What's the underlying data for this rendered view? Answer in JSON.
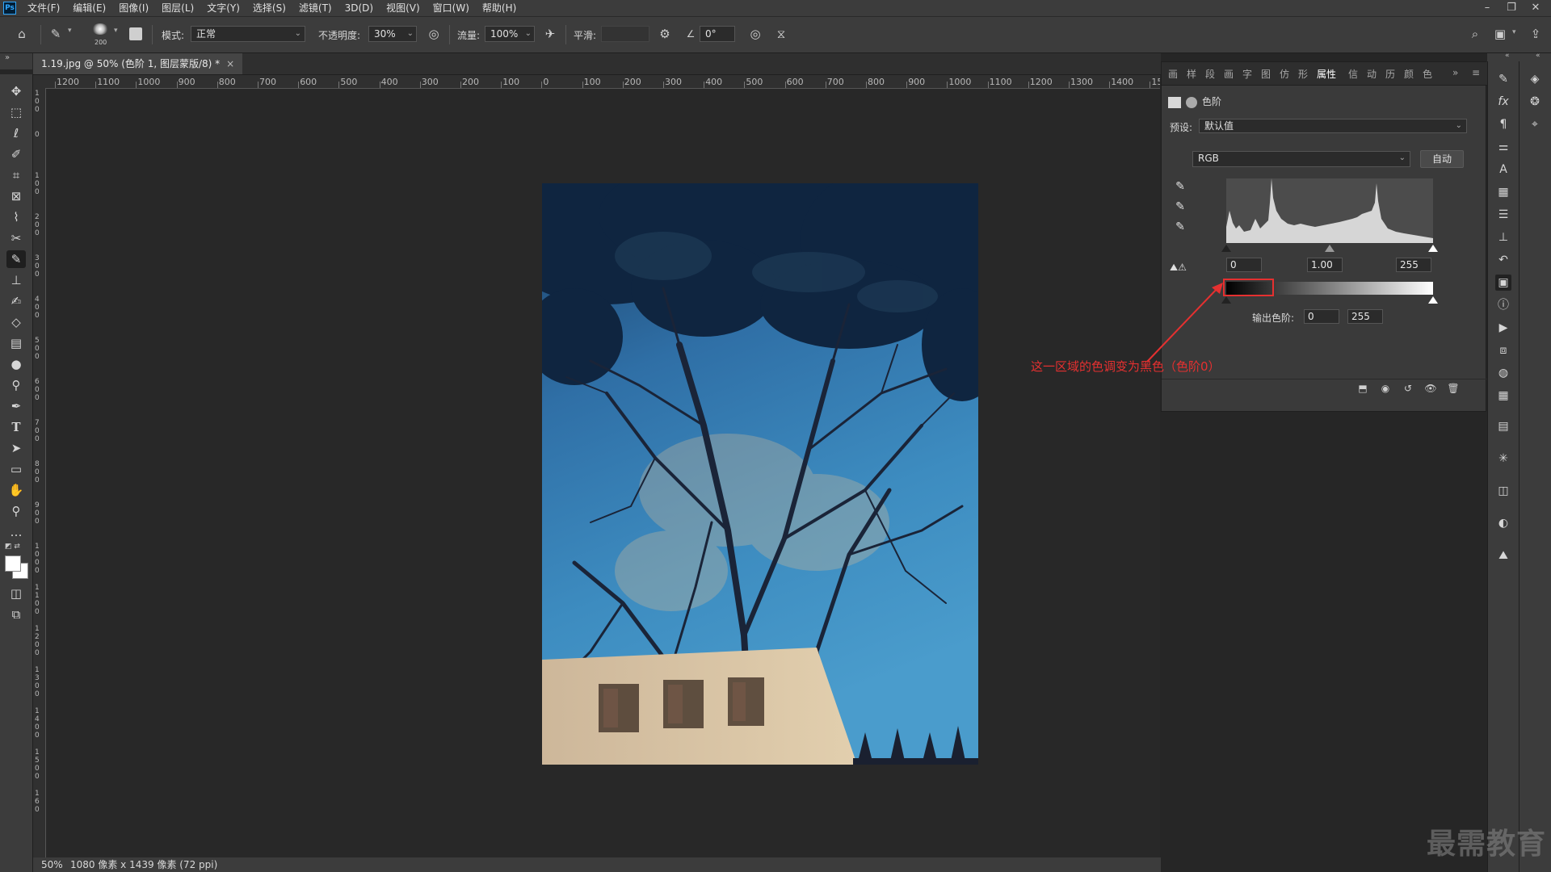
{
  "menubar": {
    "logo": "Ps",
    "items": [
      "文件(F)",
      "编辑(E)",
      "图像(I)",
      "图层(L)",
      "文字(Y)",
      "选择(S)",
      "滤镜(T)",
      "3D(D)",
      "视图(V)",
      "窗口(W)",
      "帮助(H)"
    ],
    "window_controls": [
      "–",
      "❐",
      "✕"
    ]
  },
  "options": {
    "brush_size": "200",
    "mode_label": "模式:",
    "mode_value": "正常",
    "opacity_label": "不透明度:",
    "opacity_value": "30%",
    "flow_label": "流量:",
    "flow_value": "100%",
    "smooth_label": "平滑:",
    "smooth_value": "",
    "angle_value": "0°"
  },
  "document": {
    "tab_title": "1.19.jpg @ 50% (色阶 1, 图层蒙版/8) *",
    "tab_close": "×"
  },
  "ruler": {
    "h_labels": [
      "1200",
      "1100",
      "1000",
      "900",
      "800",
      "700",
      "600",
      "500",
      "400",
      "300",
      "200",
      "100",
      "0",
      "100",
      "200",
      "300",
      "400",
      "500",
      "600",
      "700",
      "800",
      "900",
      "1000",
      "1100",
      "1200",
      "1300",
      "1400",
      "15"
    ],
    "v_labels": [
      "1 0 0",
      "0",
      "1 0 0",
      "2 0 0",
      "3 0 0",
      "4 0 0",
      "5 0 0",
      "6 0 0",
      "7 0 0",
      "8 0 0",
      "9 0 0",
      "1 0 0 0",
      "1 1 0 0",
      "1 2 0 0",
      "1 3 0 0",
      "1 4 0 0",
      "1 5 0 0",
      "1 6 0"
    ]
  },
  "status": {
    "zoom": "50%",
    "info": "1080 像素 x 1439 像素 (72 ppi)"
  },
  "panel": {
    "tabs": [
      "画",
      "样",
      "段",
      "画",
      "字",
      "图",
      "仿",
      "形",
      "属性",
      "信",
      "动",
      "历",
      "颜",
      "色"
    ],
    "active_tab": "属性",
    "title": "色阶",
    "preset_label": "预设:",
    "preset_value": "默认值",
    "channel_value": "RGB",
    "auto_button": "自动",
    "input_black": "0",
    "input_gamma": "1.00",
    "input_white": "255",
    "output_label": "输出色阶:",
    "output_black": "0",
    "output_white": "255"
  },
  "annotation": {
    "text": "这一区域的色调变为黑色（色阶0）",
    "color": "#e53030"
  },
  "watermark": "最需教育",
  "tools": [
    "move-icon",
    "marquee-icon",
    "lasso-icon",
    "quick-select-icon",
    "crop-icon",
    "frame-icon",
    "eyedropper-icon",
    "healing-icon",
    "brush-icon",
    "stamp-icon",
    "history-brush-icon",
    "eraser-icon",
    "gradient-icon",
    "blur-icon",
    "dodge-icon",
    "pen-icon",
    "type-icon",
    "path-select-icon",
    "rectangle-icon",
    "hand-icon",
    "zoom-icon",
    "more-icon"
  ],
  "right_icons_col1": [
    "brush-settings-icon",
    "adjust-icon",
    "paragraph-icon",
    "channels-adjust-icon",
    "character-icon",
    "glyphs-icon",
    "paragraph-styles-icon",
    "stamp-preset-icon",
    "history-icon",
    "properties-icon",
    "info-icon",
    "actions-icon",
    "paths-icon",
    "3d-icon",
    "table-icon",
    "notes-icon",
    "asterisk-icon",
    "libraries-icon",
    "adjustments-icon",
    "histogram-icon"
  ],
  "right_icons_col2": [
    "layers-icon",
    "channels-icon",
    "paths-icon"
  ],
  "colors": {
    "accent": "#31a8ff",
    "annotation": "#e53030",
    "ui_bg": "#3c3c3c",
    "canvas_bg": "#282828"
  }
}
